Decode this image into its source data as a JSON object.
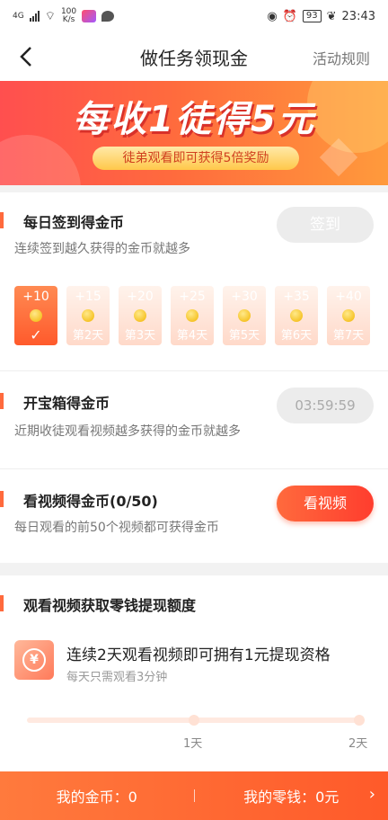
{
  "status_bar": {
    "network_label": "4G",
    "speed_value": "100",
    "speed_unit": "K/s",
    "battery": "93",
    "time": "23:43"
  },
  "nav": {
    "title": "做任务领现金",
    "rules_link": "活动规则"
  },
  "banner": {
    "headline": "每收1徒得5元",
    "subline": "徒弟观看即可获得5倍奖励"
  },
  "checkin": {
    "title": "每日签到得金币",
    "desc": "连续签到越久获得的金币就越多",
    "button": "签到",
    "days": [
      {
        "amount": "+10",
        "label": "",
        "checked": true
      },
      {
        "amount": "+15",
        "label": "第2天"
      },
      {
        "amount": "+20",
        "label": "第3天"
      },
      {
        "amount": "+25",
        "label": "第4天"
      },
      {
        "amount": "+30",
        "label": "第5天"
      },
      {
        "amount": "+35",
        "label": "第6天"
      },
      {
        "amount": "+40",
        "label": "第7天"
      }
    ]
  },
  "treasure": {
    "title": "开宝箱得金币",
    "desc": "近期收徒观看视频越多获得的金币就越多",
    "timer": "03:59:59"
  },
  "video": {
    "title": "看视频得金币(0/50)",
    "desc": "每日观看的前50个视频都可获得金币",
    "button": "看视频"
  },
  "withdraw": {
    "title": "观看视频获取零钱提现额度",
    "headline": "连续2天观看视频即可拥有1元提现资格",
    "sub": "每天只需观看3分钟",
    "progress": 0,
    "ticks": [
      "1天",
      "2天"
    ]
  },
  "bottom": {
    "coins": "我的金币：0",
    "cash": "我的零钱：0元",
    "arrow": "›"
  },
  "colors": {
    "accent": "#ff5a2c",
    "banner_gradient_start": "#ff4f4f",
    "banner_gradient_end": "#ff9a3c"
  }
}
